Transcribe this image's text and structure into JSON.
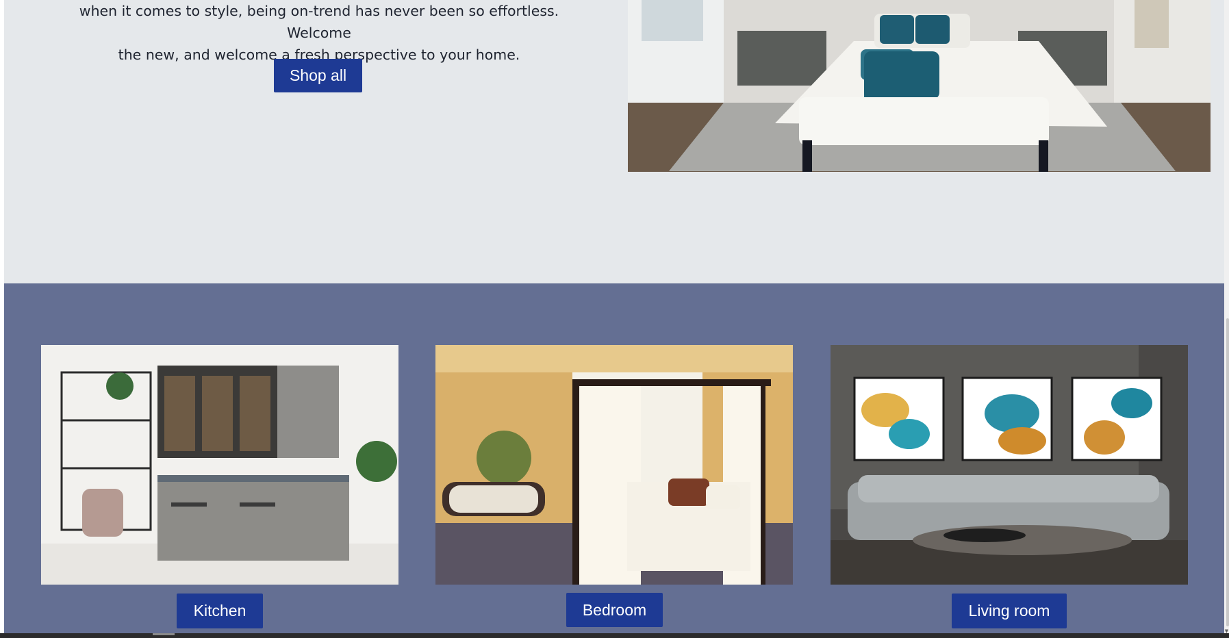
{
  "hero": {
    "line1": "when it comes to style, being on-trend has never been so effortless. Welcome",
    "line2": "the new, and welcome a fresh perspective to your home.",
    "button_label": "Shop all"
  },
  "categories": [
    {
      "label": "Kitchen"
    },
    {
      "label": "Bedroom"
    },
    {
      "label": "Living room"
    }
  ],
  "colors": {
    "page_bg": "#e5e8eb",
    "section_bg": "#646f93",
    "button_bg": "#1e3a94",
    "button_text": "#ffffff"
  }
}
